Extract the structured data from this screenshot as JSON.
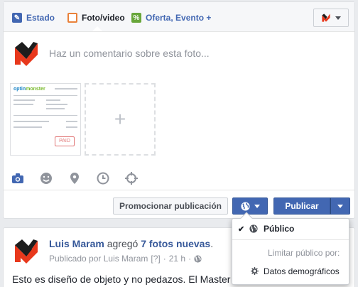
{
  "composer": {
    "tabs": [
      {
        "label": "Estado",
        "icon": "pencil-icon"
      },
      {
        "label": "Foto/video",
        "icon": "photo-icon"
      },
      {
        "label": "Oferta, Evento +",
        "icon": "offer-icon"
      }
    ],
    "comment_placeholder": "Haz un comentario sobre esta foto...",
    "thumbnail": {
      "brand_primary": "optin",
      "brand_secondary": "monster",
      "stamp": "PAID"
    },
    "tools": [
      "camera-icon",
      "emoji-icon",
      "location-pin-icon",
      "clock-icon",
      "target-icon"
    ],
    "promote_label": "Promocionar publicación",
    "publish_label": "Publicar"
  },
  "audience_dropdown": {
    "selected": "Público",
    "limit_label": "Limitar público por:",
    "demographics_label": "Datos demográficos"
  },
  "post": {
    "author": "Luis Maram",
    "action_prefix": "agregó",
    "action_link": "7 fotos nuevas",
    "action_suffix": ".",
    "meta_prefix": "Publicado por Luis Maram",
    "meta_help": "[?]",
    "meta_sep": "·",
    "meta_time": "21 h",
    "meta_dot": "·",
    "text": "Esto es diseño de objeto y no pedazos. El Master Builder Yary, de capen,"
  },
  "colors": {
    "accent": "#4267b2",
    "link": "#365899",
    "offer": "#68a63a",
    "photo": "#e9813a"
  }
}
